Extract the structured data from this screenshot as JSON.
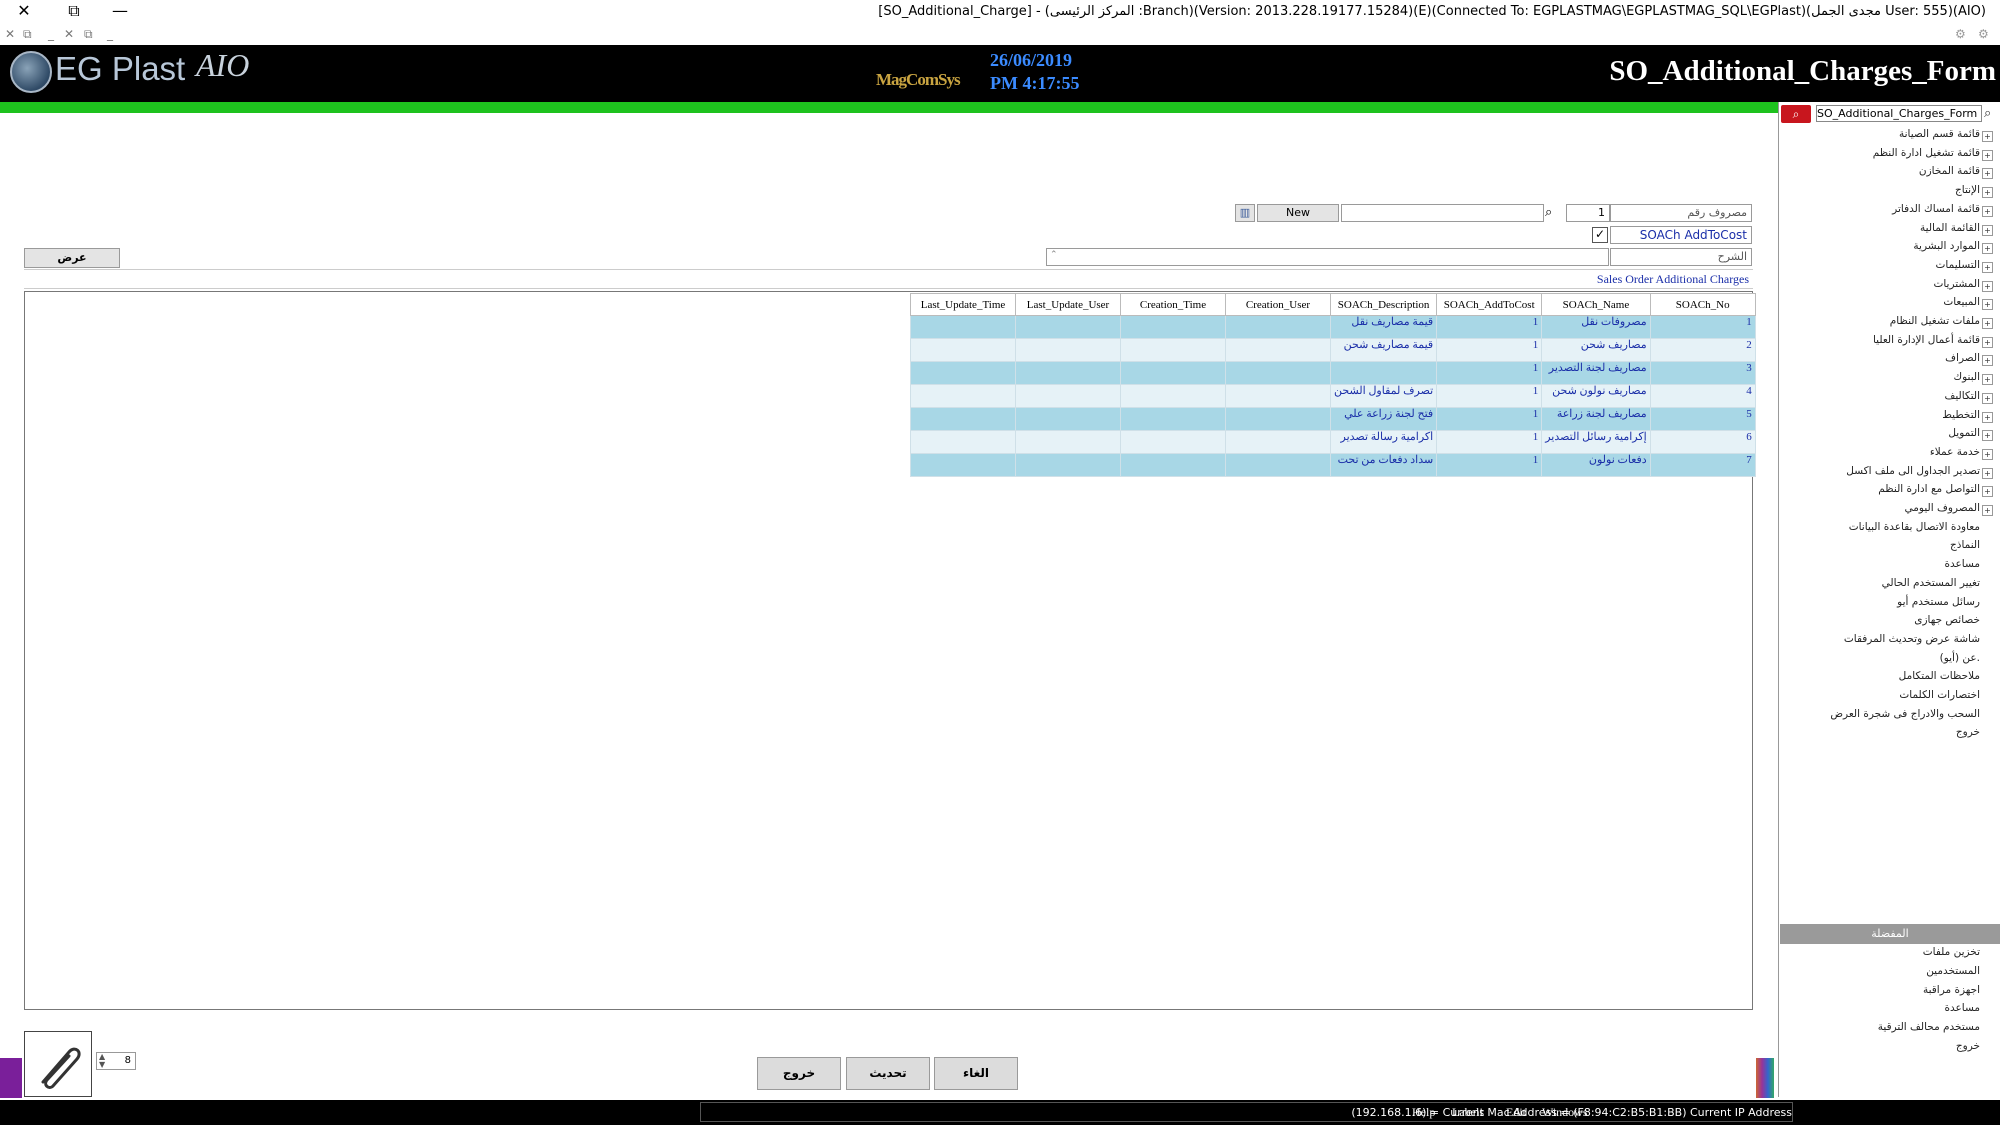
{
  "window": {
    "title": "[SO_Additional_Charge] - (المركز الرئيسى :Branch)(Version: 2013.228.19177.15284)(E)(Connected To: EGPLASTMAG\\EGPLASTMAG_SQL\\EGPlast)(مجدى الجمل User: 555)(AIO)",
    "close": "✕",
    "restore": "⧉",
    "minimize": "—"
  },
  "toolstrip": [
    "✕",
    "⧉",
    "_",
    "✕",
    "⧉",
    "_"
  ],
  "header": {
    "logo_text": "EG Plast",
    "logo_script": "AIO",
    "brand_mark": "MagComSys",
    "date": "26/06/2019",
    "time": "PM 4:17:55",
    "form_title": "SO_Additional_Charges_Form"
  },
  "form": {
    "expense_no_label": "مصروف رقم",
    "expense_no_value": "1",
    "new_label": "New",
    "addtocost_label": "SOACh AddToCost",
    "description_label": "الشرح",
    "view_button": "عرض",
    "section_title": "Sales Order Additional Charges"
  },
  "grid": {
    "columns": [
      "Last_Update_Time",
      "Last_Update_User",
      "Creation_Time",
      "Creation_User",
      "SOACh_Description",
      "SOACh_AddToCost",
      "SOACh_Name",
      "SOACh_No"
    ],
    "rows": [
      {
        "no": "1",
        "name": "مصروفات نقل",
        "addtocost": "1",
        "description": "قيمة مصاريف نقل"
      },
      {
        "no": "2",
        "name": "مصاريف شحن",
        "addtocost": "1",
        "description": "قيمة مصاريف شحن"
      },
      {
        "no": "3",
        "name": "مصاريف لجنة التصدير",
        "addtocost": "1",
        "description": ""
      },
      {
        "no": "4",
        "name": "مصاريف نولون شحن",
        "addtocost": "1",
        "description": "تصرف لمقاول الشحن"
      },
      {
        "no": "5",
        "name": "مصاريف لجنة زراعة",
        "addtocost": "1",
        "description": "فتح لجنة زراعة علي"
      },
      {
        "no": "6",
        "name": "إكرامية رسائل التصدير",
        "addtocost": "1",
        "description": "أكرامية رسالة تصدير"
      },
      {
        "no": "7",
        "name": "دفعات نولون",
        "addtocost": "1",
        "description": "سداد دفعات من تحت"
      }
    ]
  },
  "bottom": {
    "page_value": "8",
    "cancel_button": "الغاء",
    "update_button": "تحديث",
    "exit_button": "خروج"
  },
  "sidebar": {
    "search_value": "SO_Additional_Charges_Form",
    "tree": [
      {
        "label": "قائمة قسم الصيانة",
        "expandable": true
      },
      {
        "label": "قائمة تشغيل ادارة النظم",
        "expandable": true
      },
      {
        "label": "قائمة المخازن",
        "expandable": true
      },
      {
        "label": "الإنتاج",
        "expandable": true
      },
      {
        "label": "قائمة امساك الدفاتر",
        "expandable": true
      },
      {
        "label": "القائمة المالية",
        "expandable": true
      },
      {
        "label": "الموارد البشرية",
        "expandable": true
      },
      {
        "label": "التسليمات",
        "expandable": true
      },
      {
        "label": "المشتريات",
        "expandable": true
      },
      {
        "label": "المبيعات",
        "expandable": true
      },
      {
        "label": "ملفات تشغيل النظام",
        "expandable": true
      },
      {
        "label": "قائمة أعمال الإدارة العليا",
        "expandable": true
      },
      {
        "label": "الصراف",
        "expandable": true
      },
      {
        "label": "البنوك",
        "expandable": true
      },
      {
        "label": "التكاليف",
        "expandable": true
      },
      {
        "label": "التخطيط",
        "expandable": true
      },
      {
        "label": "التمويل",
        "expandable": true
      },
      {
        "label": "خدمة عملاء",
        "expandable": true
      },
      {
        "label": "تصدير الجداول الى ملف اكسل",
        "expandable": true
      },
      {
        "label": "التواصل مع ادارة النظم",
        "expandable": true
      },
      {
        "label": "المصروف اليومي",
        "expandable": true
      },
      {
        "label": "معاودة الاتصال بقاعدة البيانات",
        "expandable": false
      },
      {
        "label": "النماذج",
        "expandable": false
      },
      {
        "label": "مساعدة",
        "expandable": false
      },
      {
        "label": "تغيير المستخدم الحالي",
        "expandable": false
      },
      {
        "label": "رسائل مستخدم أيو",
        "expandable": false
      },
      {
        "label": "خصائص جهازى",
        "expandable": false
      },
      {
        "label": "شاشة عرض وتحديث المرفقات",
        "expandable": false
      },
      {
        "label": "عن (أيو).",
        "expandable": false
      },
      {
        "label": "ملاحظات المتكامل",
        "expandable": false
      },
      {
        "label": "اختصارات الكلمات",
        "expandable": false
      },
      {
        "label": "السحب والادراج فى شجرة العرض",
        "expandable": false
      },
      {
        "label": "خروج",
        "expandable": false
      }
    ],
    "favorites_title": "المفضلة",
    "favorites": [
      "تخزين ملفات",
      "المستخدمين",
      "اجهزة مراقبة",
      "مساعدة",
      "مستخدم محالف الترقية",
      "خروج"
    ]
  },
  "status": {
    "text": "(192.168.1.6) = Current Mac Address = (F8:94:C2:B5:B1:BB) Current IP Address",
    "menus": [
      "Help",
      "Labels",
      "Edit",
      "Windows"
    ]
  },
  "colors": {
    "header_bg": "#000000",
    "accent_green": "#1ec21e",
    "title_white": "#ffffff",
    "date_blue": "#3b8bff",
    "grid_row_shaded": "#a8d7e6",
    "search_red": "#c8161e"
  }
}
